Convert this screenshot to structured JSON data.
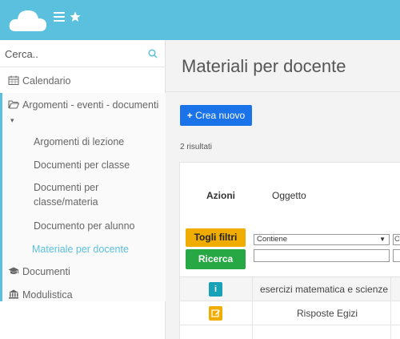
{
  "topbar": {
    "color": "#5bc0de",
    "icons": [
      "cloud-logo",
      "hamburger-icon",
      "star-icon"
    ]
  },
  "sidebar": {
    "search_placeholder": "Cerca..",
    "items": [
      {
        "icon": "calendar-icon",
        "label": "Calendario"
      },
      {
        "icon": "folder-open-icon",
        "label": "Argomenti - eventi - documenti",
        "caret": "▾"
      }
    ],
    "subitems": [
      {
        "label": "Argomenti di lezione",
        "active": false
      },
      {
        "label": "Documenti per classe",
        "active": false
      },
      {
        "label": "Documenti per classe/materia",
        "active": false
      },
      {
        "label": "Documento per alunno",
        "active": false
      },
      {
        "label": "Materiale per docente",
        "active": true
      }
    ],
    "bottom_items": [
      {
        "icon": "graduation-cap-icon",
        "label": "Documenti"
      },
      {
        "icon": "bank-icon",
        "label": "Modulistica"
      }
    ]
  },
  "main": {
    "title": "Materiali per docente",
    "new_button_label": "Crea nuovo",
    "new_button_icon": "+",
    "results_text": "2 risultati",
    "table": {
      "headers": {
        "actions": "Azioni",
        "subject": "Oggetto"
      },
      "filter_button": "Togli filtri",
      "search_button": "Ricerca",
      "filter_select_value": "Contiene",
      "filter_select2_value": "C",
      "rows": [
        {
          "action_icon": "info-icon",
          "action_label": "i",
          "subject": "esercizi matematica e scienze"
        },
        {
          "action_icon": "edit-icon",
          "action_label": "",
          "subject": "Risposte Egizi"
        }
      ]
    }
  },
  "colors": {
    "accent": "#5bc0de",
    "primary": "#1a73e8",
    "warning": "#f0ad00",
    "success": "#28a745",
    "info": "#17a2b8"
  }
}
